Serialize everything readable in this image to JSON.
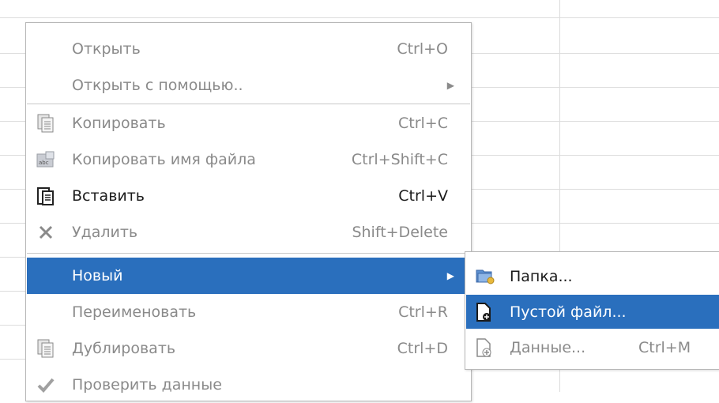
{
  "menu": {
    "items": [
      {
        "label": "Открыть",
        "shortcut": "Ctrl+O",
        "icon": "none"
      },
      {
        "label": "Открыть с помощью..",
        "arrow": "▶",
        "icon": "none"
      },
      {
        "label": "Копировать",
        "shortcut": "Ctrl+C",
        "icon": "copy-icon"
      },
      {
        "label": "Копировать имя файла",
        "shortcut": "Ctrl+Shift+C",
        "icon": "copy-filename-icon"
      },
      {
        "label": "Вставить",
        "shortcut": "Ctrl+V",
        "icon": "paste-icon"
      },
      {
        "label": "Удалить",
        "shortcut": "Shift+Delete",
        "icon": "delete-icon"
      },
      {
        "label": "Новый",
        "arrow": "▶",
        "icon": "none"
      },
      {
        "label": "Переименовать",
        "shortcut": "Ctrl+R",
        "icon": "none"
      },
      {
        "label": "Дублировать",
        "shortcut": "Ctrl+D",
        "icon": "duplicate-icon"
      },
      {
        "label": "Проверить данные",
        "icon": "check-icon"
      }
    ]
  },
  "submenu": {
    "items": [
      {
        "label": "Папка...",
        "icon": "folder-icon"
      },
      {
        "label": "Пустой файл...",
        "icon": "new-file-icon"
      },
      {
        "label": "Данные...",
        "shortcut": "Ctrl+M",
        "icon": "new-data-icon"
      }
    ]
  },
  "colors": {
    "highlight": "#2a6fbd",
    "disabled_text": "#8a8a8a",
    "text": "#1a1a1a"
  }
}
